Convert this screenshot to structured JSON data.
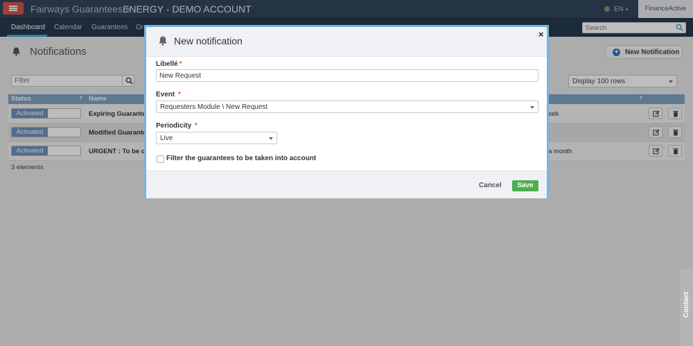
{
  "header": {
    "app_title": "Fairways Guarantees >",
    "account_title": "ENERGY - DEMO ACCOUNT",
    "language": "EN",
    "brand": "FinanceActive"
  },
  "nav": {
    "items": [
      {
        "label": "Dashboard"
      },
      {
        "label": "Calendar"
      },
      {
        "label": "Guarantees"
      },
      {
        "label": "Or"
      }
    ],
    "search_placeholder": "Search"
  },
  "page": {
    "title": "Notifications",
    "new_button": "New Notification",
    "filter_placeholder": "Filter",
    "rows_selector": "Display 100 rows",
    "count_label": "3 elements"
  },
  "table": {
    "columns": [
      "Status",
      "Name"
    ],
    "rows": [
      {
        "status": "Activated",
        "name": "Expiring Guarantee",
        "periodicity": "eek"
      },
      {
        "status": "Activated",
        "name": "Modified Guarantee",
        "periodicity": ""
      },
      {
        "status": "Activated",
        "name": "URGENT : To be clo",
        "periodicity": "a month"
      }
    ]
  },
  "modal": {
    "title": "New notification",
    "close": "×",
    "libelle_label": "Libellé",
    "libelle_value": "New Request",
    "event_label": "Event",
    "event_value": "Requesters Module \\ New Request",
    "periodicity_label": "Periodicity",
    "periodicity_value": "Live",
    "filter_checkbox_label": "Filter the guarantees to be taken into account",
    "required_mark": "*",
    "cancel": "Cancel",
    "save": "Save"
  },
  "contact_tab": "Contact",
  "colors": {
    "header_bg": "#33475e",
    "nav_bg": "#263a4f",
    "menu_button": "#d9534f",
    "table_header": "#7fa3c3",
    "toggle_on": "#6d94bf",
    "modal_border": "#7ab4e0",
    "save_button": "#4cae4c",
    "new_button_icon": "#2c79c6"
  }
}
